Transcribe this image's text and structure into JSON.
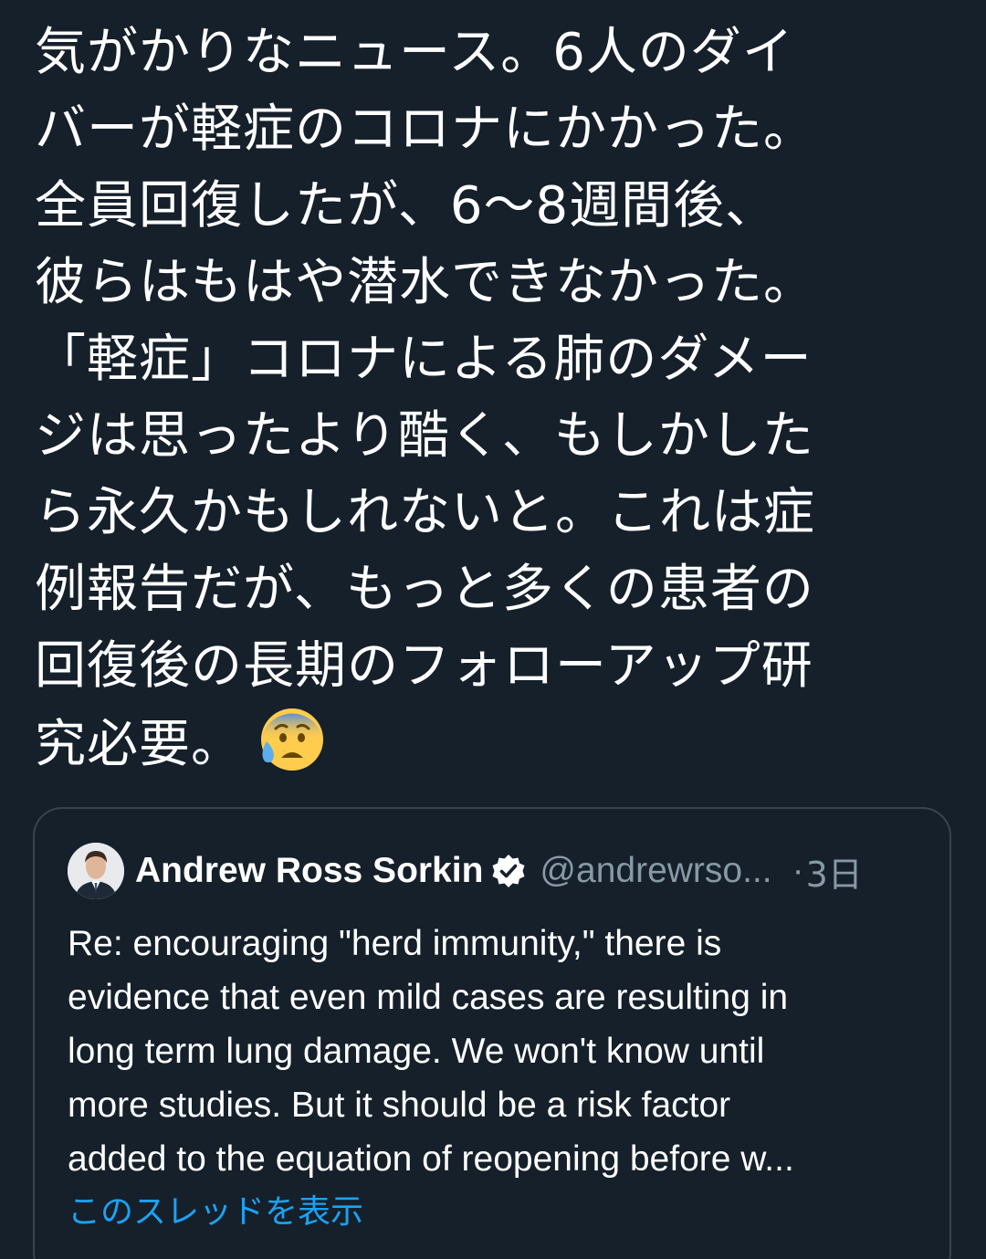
{
  "tweet": {
    "text_lines": [
      "気がかりなニュース。6人のダイ",
      "バーが軽症のコロナにかかった。",
      "全員回復したが、6〜8週間後、",
      "彼らはもはや潜水できなかった。",
      "「軽症」コロナによる肺のダメー",
      "ジは思ったより酷く、もしかした",
      "ら永久かもしれないと。これは症",
      "例報告だが、もっと多くの患者の",
      "回復後の長期のフォローアップ研",
      "究必要。"
    ],
    "emoji": "anxious-face-with-sweat-icon"
  },
  "quoted_tweet": {
    "author_name": "Andrew Ross Sorkin",
    "handle": "@andrewrso...",
    "separator": "·",
    "time": "3日",
    "verified_icon": "verified-badge-icon",
    "body_lines": [
      "Re: encouraging \"herd immunity,\" there is",
      "evidence that even mild cases are resulting in",
      "long term lung damage. We won't know until",
      "more studies. But it should be a risk factor",
      "added to the equation of reopening before w..."
    ],
    "show_thread_label": "このスレッドを表示"
  },
  "colors": {
    "background": "#15202b",
    "text": "#ffffff",
    "secondary_text": "#8899a6",
    "link": "#1da1f2",
    "card_border": "#38444d"
  }
}
